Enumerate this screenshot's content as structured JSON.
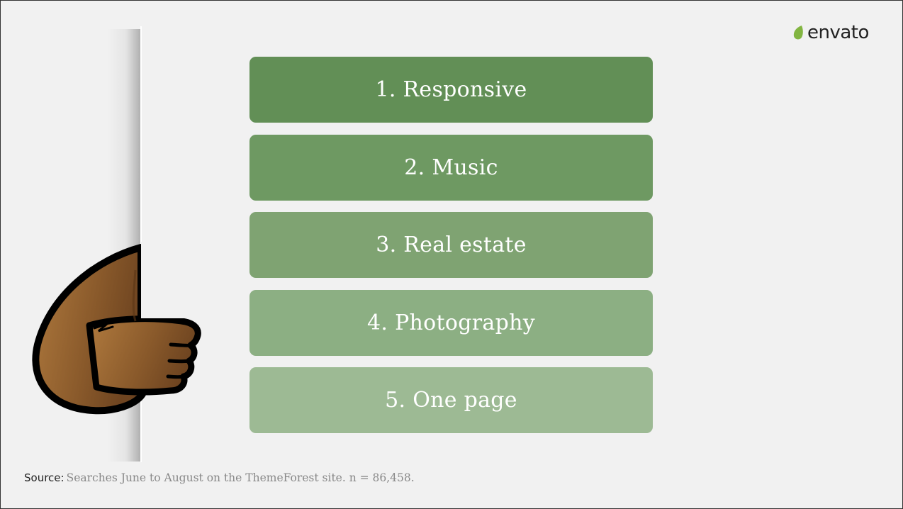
{
  "logo": {
    "text": "envato",
    "leaf_color": "#82b541"
  },
  "ranking": {
    "items": [
      {
        "label": "1. Responsive",
        "color": "#628f56"
      },
      {
        "label": "2. Music",
        "color": "#6e9962"
      },
      {
        "label": "3. Real estate",
        "color": "#7fa372"
      },
      {
        "label": "4. Photography",
        "color": "#8caf83"
      },
      {
        "label": "5. One page",
        "color": "#9dba94"
      }
    ]
  },
  "footer": {
    "source_label": "Source:",
    "source_text": "Searches June to August on the ThemeForest site. n = 86,458."
  },
  "illustration": {
    "icon": "bear-arm-icon",
    "fur_color": "#8a5a2b"
  }
}
